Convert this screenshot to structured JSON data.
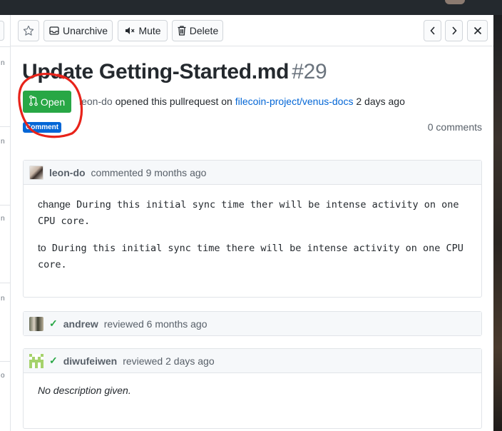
{
  "toolbar": {
    "unarchive_label": "Unarchive",
    "mute_label": "Mute",
    "delete_label": "Delete"
  },
  "pull_request": {
    "title": "Update Getting-Started.md",
    "number": "#29",
    "state": "Open",
    "author": "leon-do",
    "action_text": "opened this pullrequest on",
    "repo": "filecoin-project/venus-docs",
    "time": "2 days ago",
    "label": "Comment",
    "comments_count": "0 comments"
  },
  "timeline": [
    {
      "user": "leon-do",
      "action": "commented",
      "time": "9 months ago",
      "body": [
        {
          "lead": "change",
          "text": "During this initial sync time ther will be intense activity on one CPU core."
        },
        {
          "lead": "to",
          "text": "During this initial sync time there will be intense activity on one CPU core."
        }
      ]
    },
    {
      "user": "andrew",
      "action": "reviewed",
      "time": "6 months ago"
    },
    {
      "user": "diwufeiwen",
      "action": "reviewed",
      "time": "2 days ago",
      "body_text": "No description given."
    }
  ],
  "left_list": {
    "digits": [
      "n",
      "n",
      "n",
      "n",
      "n",
      "o"
    ]
  },
  "colors": {
    "open_green": "#28a745",
    "label_blue": "#0366d6",
    "annotation_red": "#e8231a"
  }
}
